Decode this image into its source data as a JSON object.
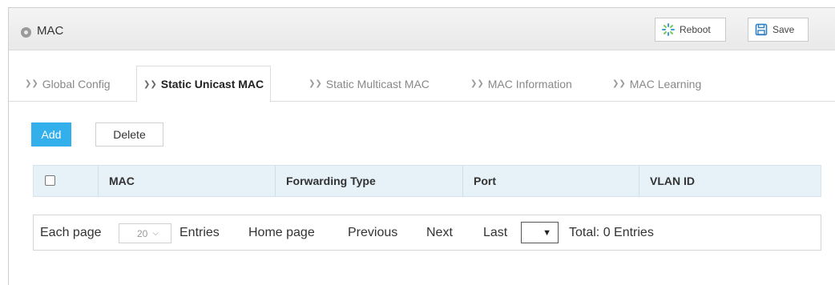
{
  "panel": {
    "title": "MAC",
    "reboot_label": "Reboot",
    "save_label": "Save",
    "icons": {
      "title": "settings-circle-icon",
      "reboot": "reboot-spinner-icon",
      "save": "floppy-disk-icon"
    }
  },
  "tabs": [
    {
      "label": "Global Config",
      "active": false
    },
    {
      "label": "Static Unicast MAC",
      "active": true
    },
    {
      "label": "Static Multicast MAC",
      "active": false
    },
    {
      "label": "MAC Information",
      "active": false
    },
    {
      "label": "MAC Learning",
      "active": false
    }
  ],
  "actions": {
    "add_label": "Add",
    "delete_label": "Delete"
  },
  "table": {
    "columns": [
      "MAC",
      "Forwarding Type",
      "Port",
      "VLAN ID"
    ],
    "rows": []
  },
  "pager": {
    "each_page_label": "Each page",
    "page_size": "20",
    "entries_label": "Entries",
    "home_label": "Home page",
    "prev_label": "Previous",
    "next_label": "Next",
    "last_label": "Last",
    "goto_value": "",
    "total_label": "Total: 0 Entries"
  },
  "colors": {
    "accent": "#33b0ec",
    "header_bg": "#e6f1f8"
  }
}
